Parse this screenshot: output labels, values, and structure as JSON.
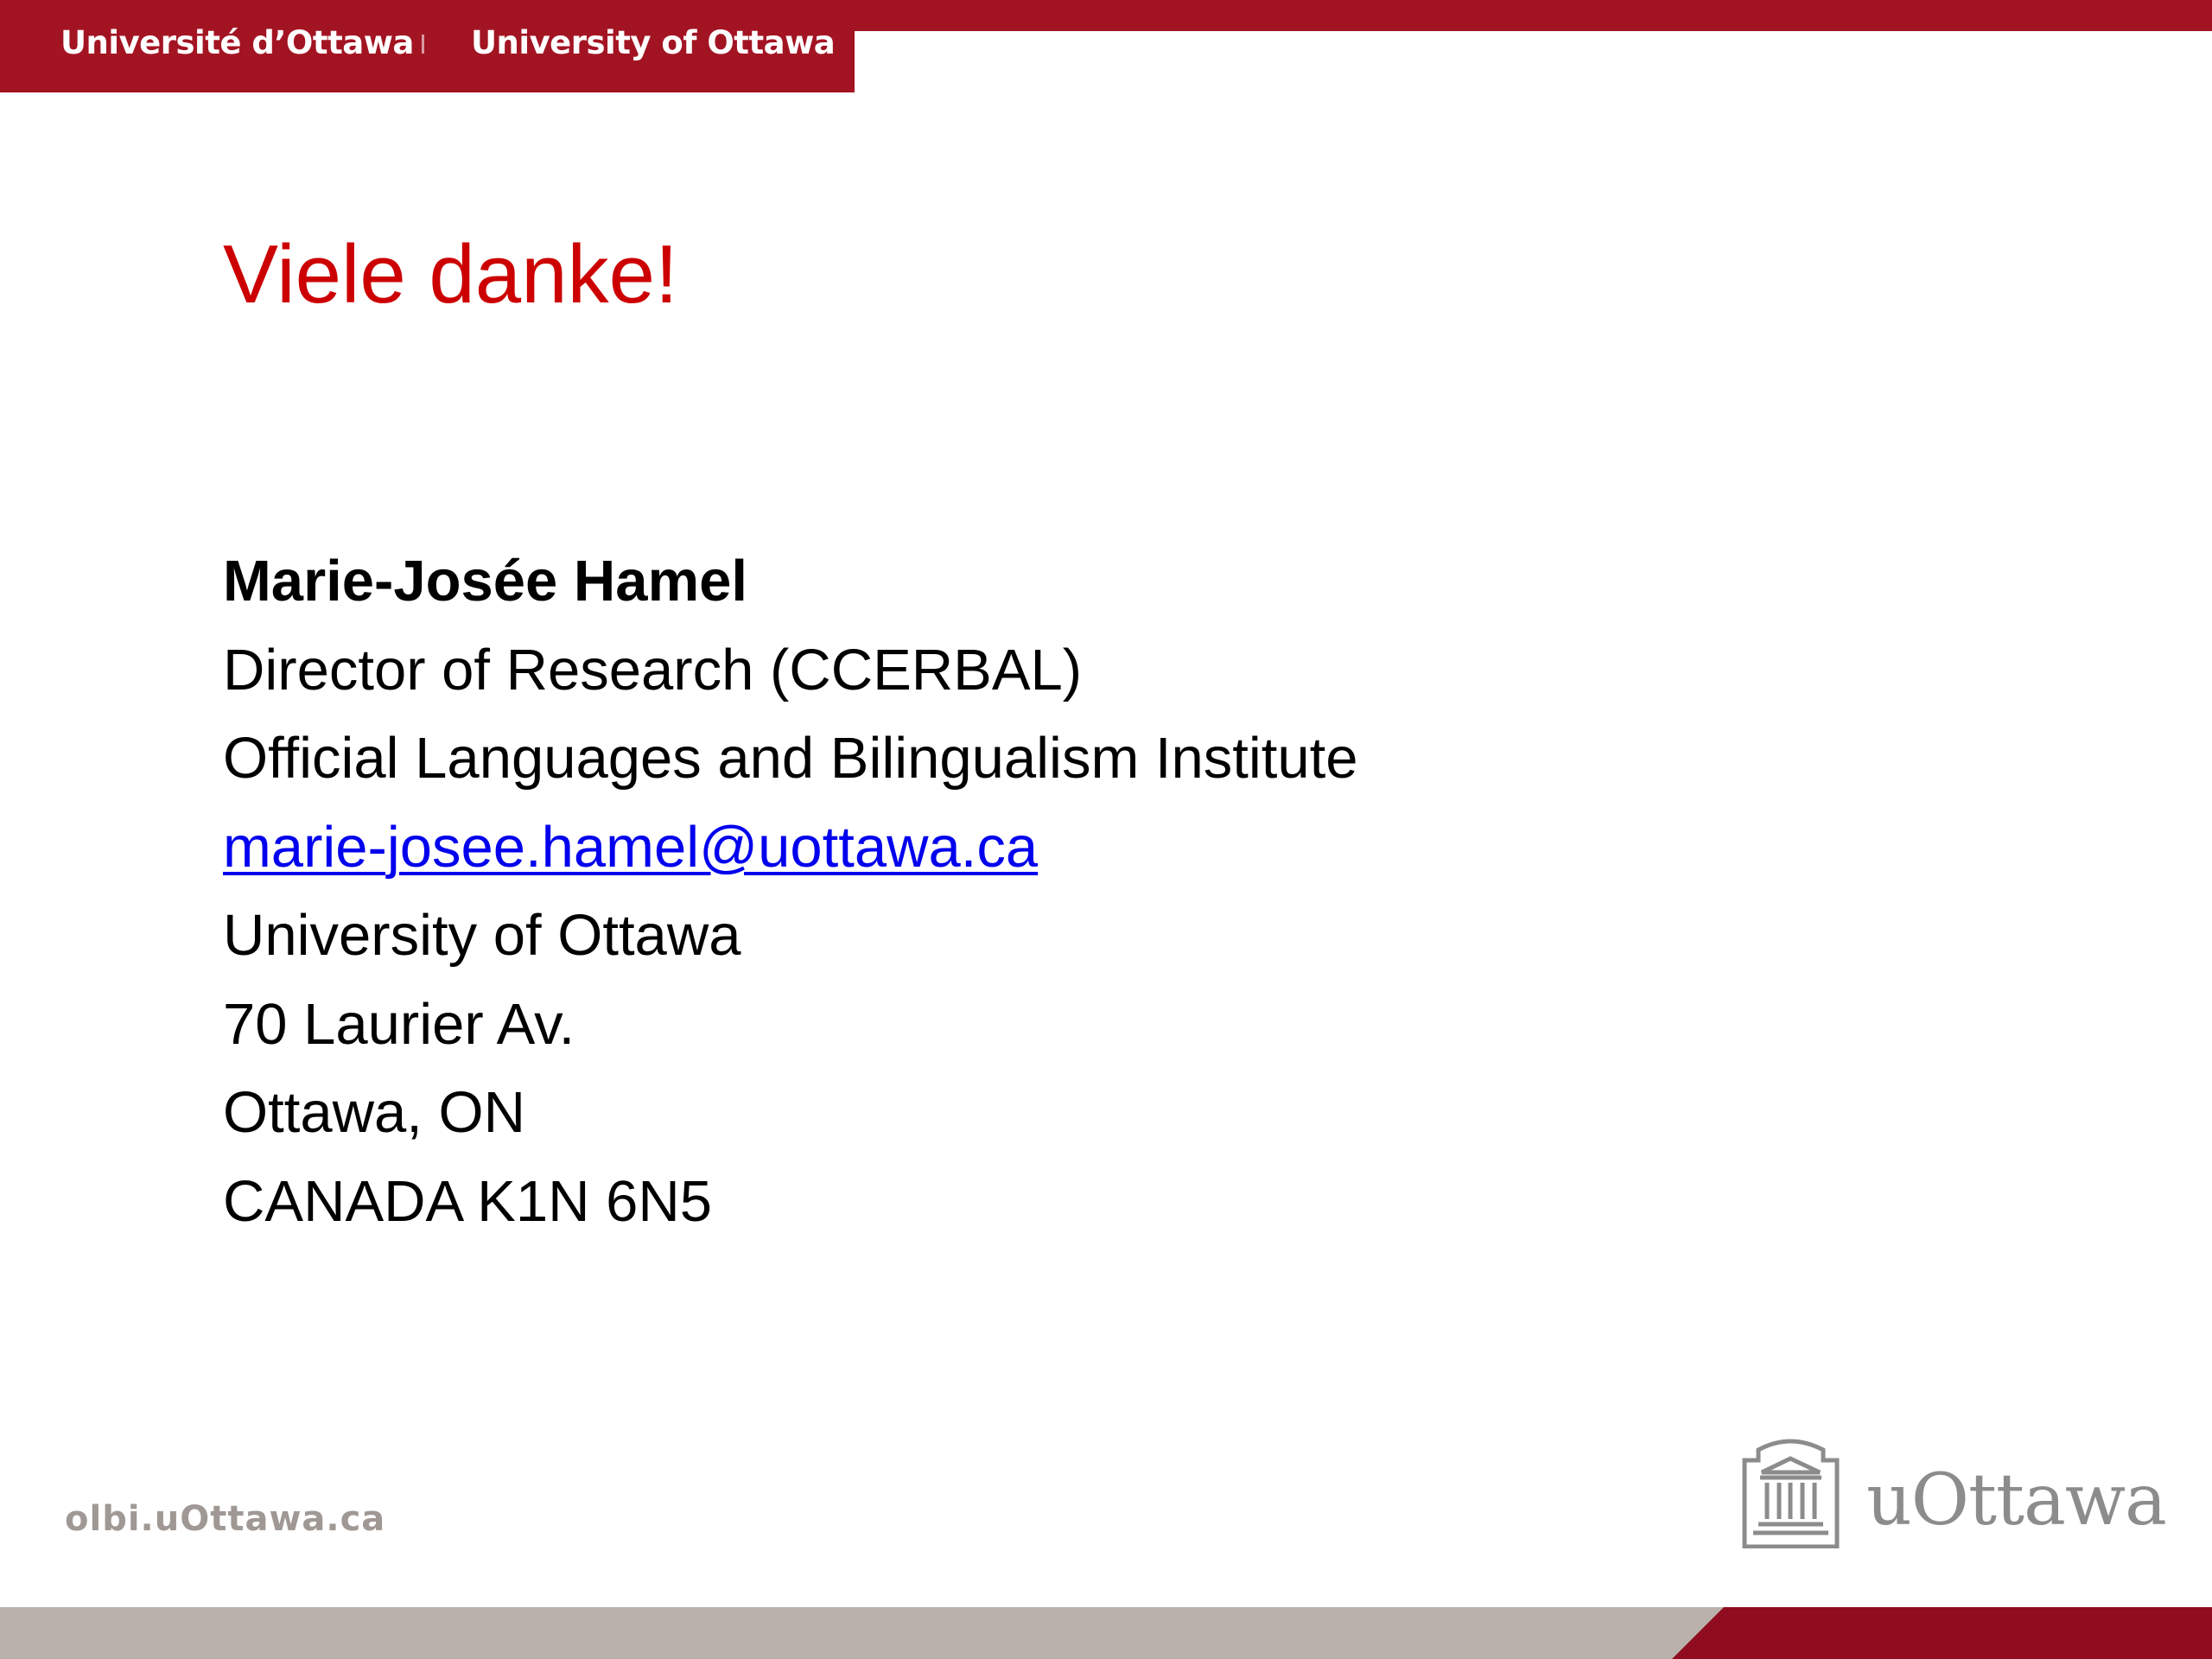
{
  "header": {
    "university_fr": "Université d’Ottawa",
    "university_en": "University of Ottawa",
    "bar_color": "#a31423"
  },
  "slide": {
    "title": "Viele danke!",
    "title_color": "#cc0000"
  },
  "contact": {
    "name": "Marie-Josée Hamel",
    "role": "Director of Research (CCERBAL)",
    "institute": "Official Languages and Bilingualism Institute",
    "email": "marie-josee.hamel@uottawa.ca",
    "university": "University of Ottawa",
    "street": "70 Laurier Av.",
    "city": "Ottawa, ON",
    "country_postal": "CANADA K1N 6N5"
  },
  "footer": {
    "url": "olbi.uOttawa.ca",
    "logo_icon": "uottawa-building-icon",
    "logo_text": "uOttawa",
    "band_grey": "#bab1ab",
    "band_red": "#8f0d1e"
  }
}
